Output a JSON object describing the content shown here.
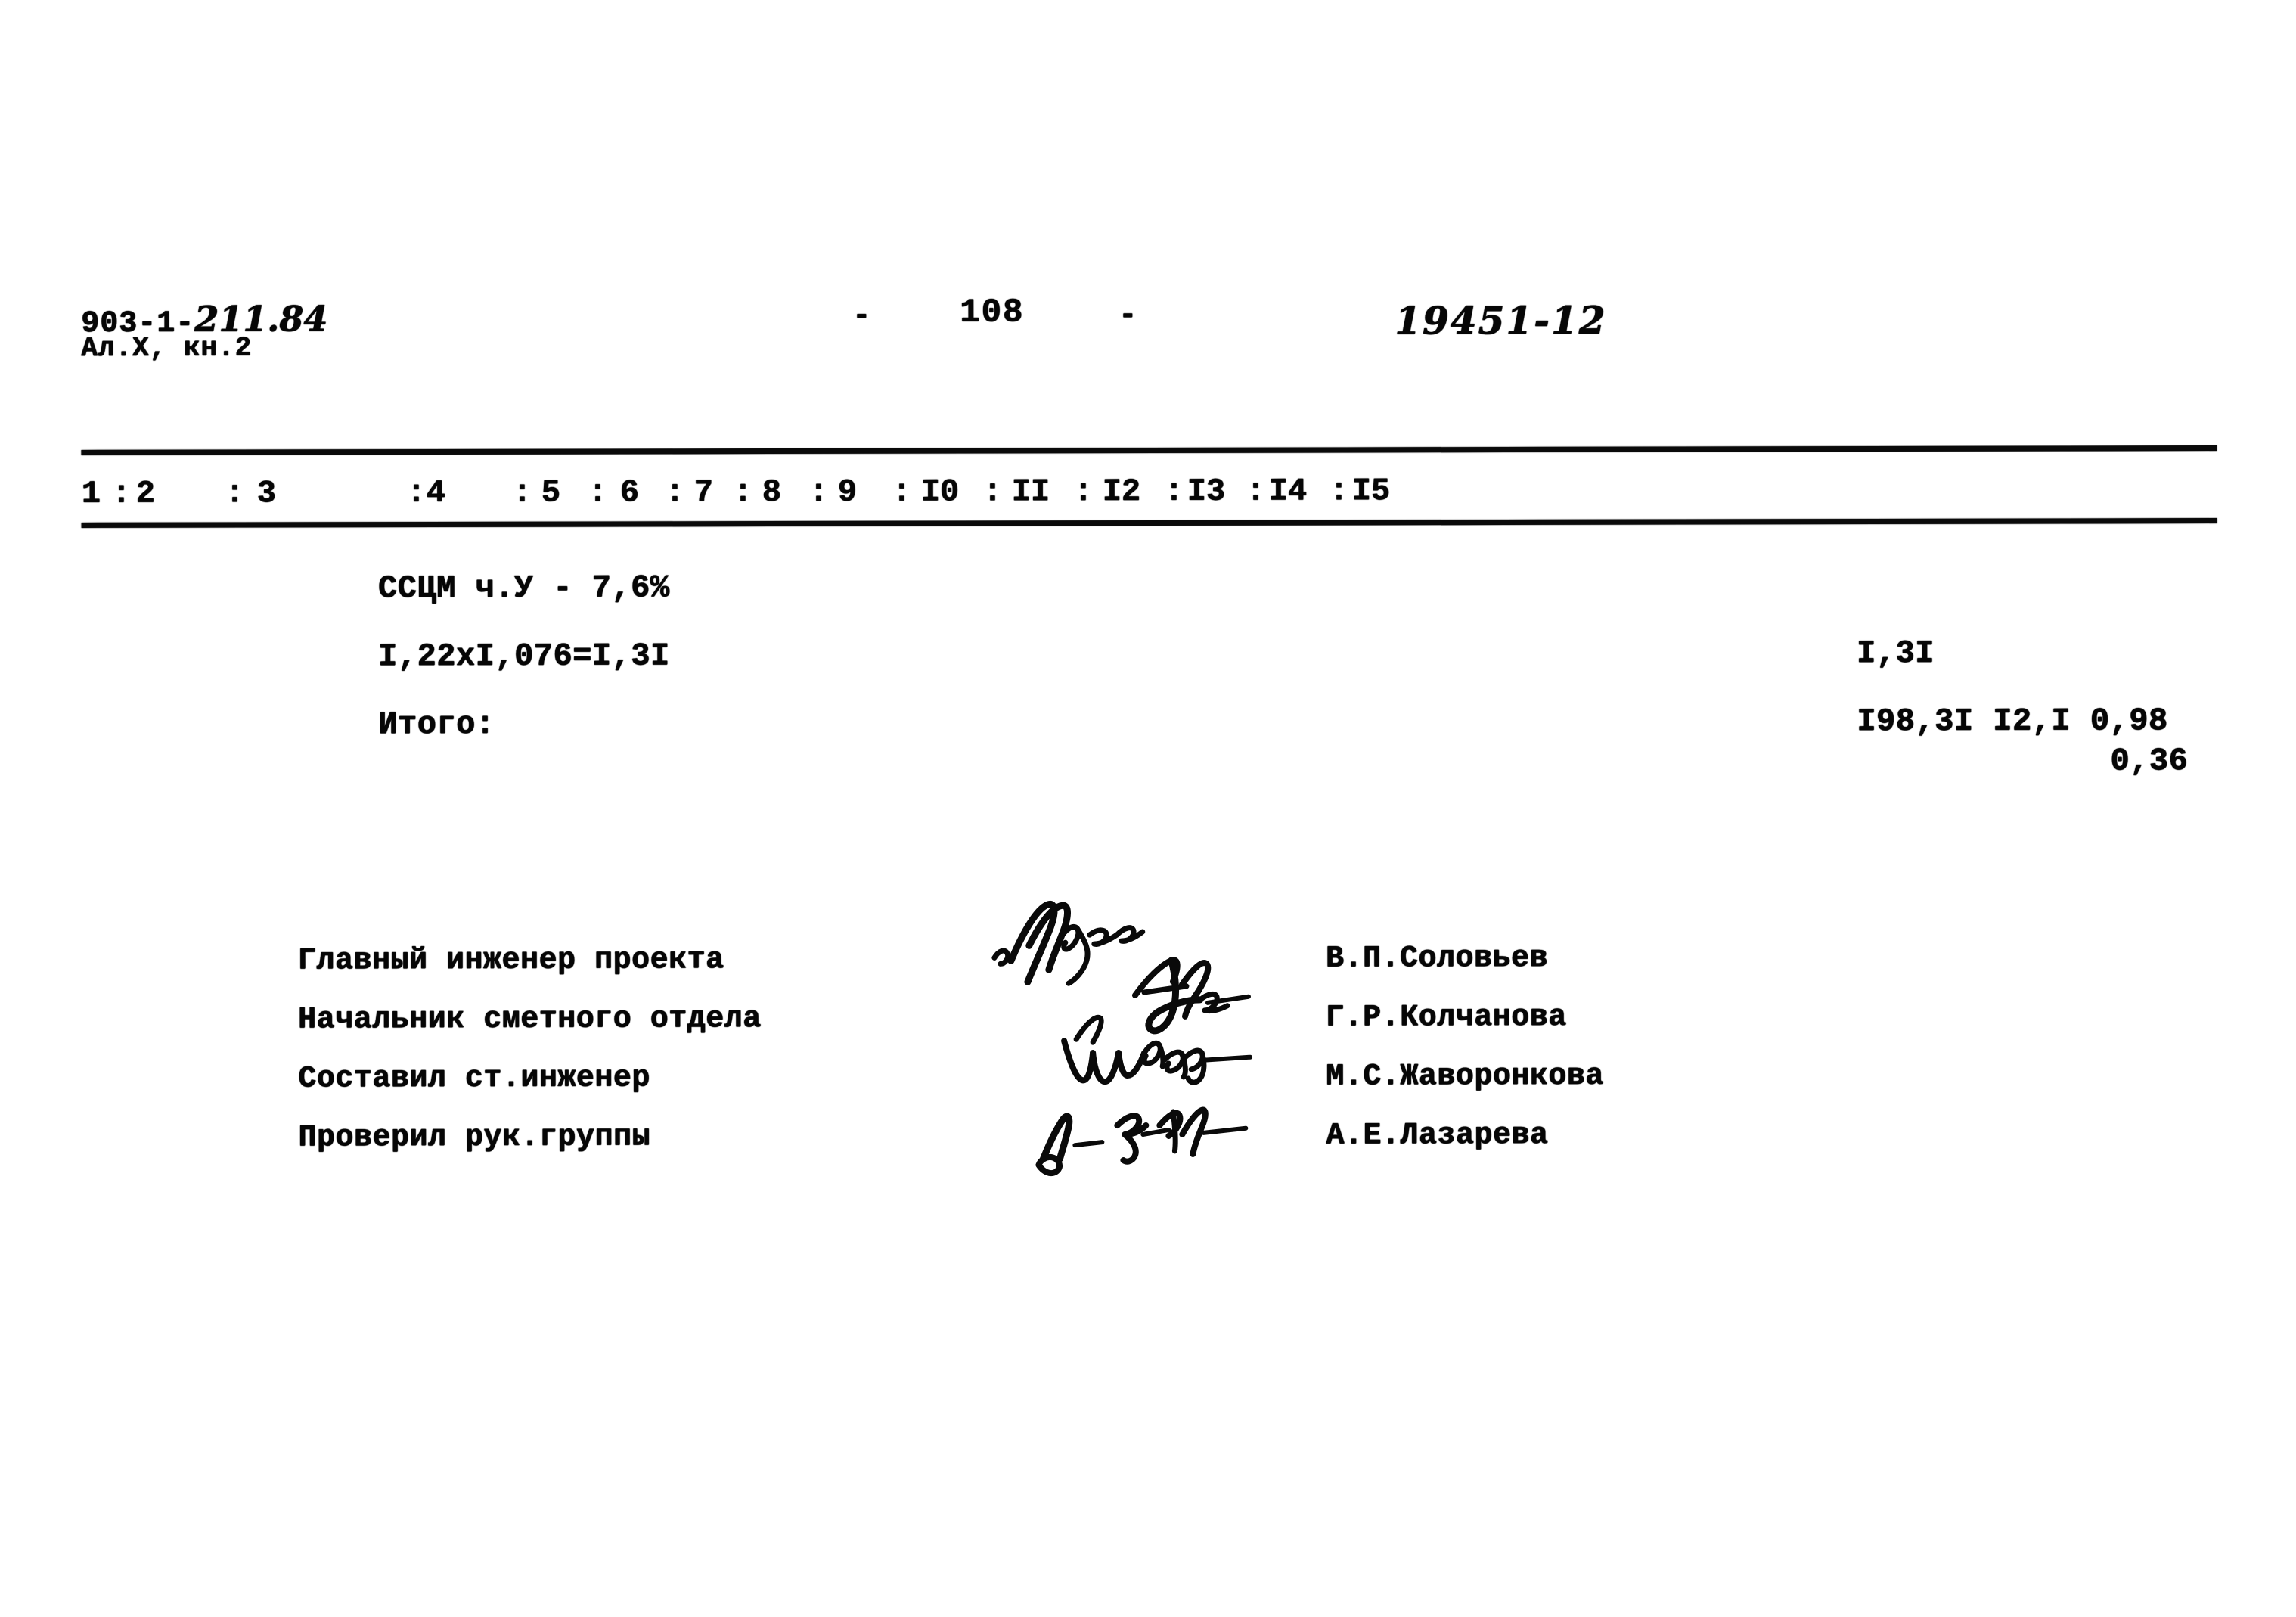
{
  "document": {
    "header": {
      "project_code_printed": "903-1-",
      "project_code_handwritten": "211.84",
      "album_line": "Ал.Х, кн.2",
      "dash_left": "-",
      "page_number": "108",
      "dash_right": "-",
      "order_number_handwritten": "19451-12"
    },
    "table": {
      "column_numbers": [
        "1",
        "2",
        "3",
        "4",
        "5",
        "6",
        "7",
        "8",
        "9",
        "I0",
        "II",
        "I2",
        "I3",
        "I4",
        "I5"
      ],
      "separator": ":",
      "rows": [
        {
          "label": "ССЦМ ч.У - 7,6%",
          "values": []
        },
        {
          "label": "I,22xI,076=I,3I",
          "values": [
            "I,3I"
          ]
        },
        {
          "label": "Итого:",
          "values": [
            "I98,3I",
            "I2,I",
            "0,98"
          ]
        }
      ],
      "extra_value": "0,36"
    },
    "signature_block": {
      "roles": [
        "Главный инженер проекта",
        "Начальник сметного отдела",
        "Составил ст.инженер",
        "Проверил рук.группы"
      ],
      "names": [
        "В.П.Соловьев",
        "Г.Р.Колчанова",
        "М.С.Жаворонкова",
        "А.Е.Лазарева"
      ],
      "signatures": [
        "signature-soloviev",
        "signature-kolchanova",
        "signature-zhavoronkova",
        "signature-lazareva"
      ]
    },
    "colors": {
      "ink": "#060606",
      "paper": "#ffffff"
    }
  }
}
